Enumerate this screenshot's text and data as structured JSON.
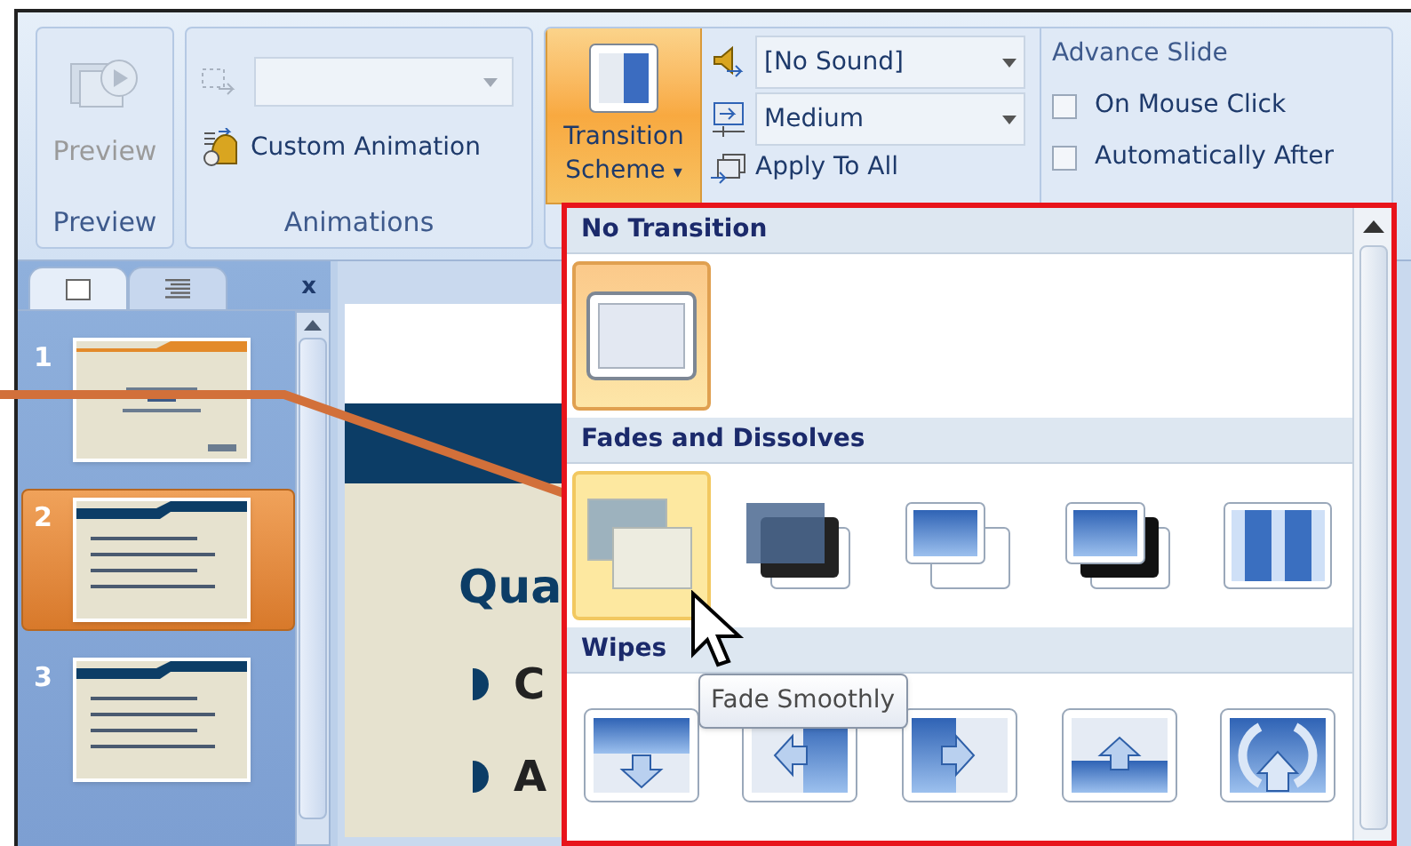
{
  "ribbon": {
    "preview_group": {
      "button": "Preview",
      "label": "Preview",
      "disabled": true
    },
    "animations_group": {
      "custom_animation": "Custom Animation",
      "label": "Animations"
    },
    "transition_group": {
      "scheme_button": "Transition",
      "scheme_button_line2": "Scheme",
      "caret": "▾",
      "sound": "[No Sound]",
      "speed": "Medium",
      "apply_all": "Apply To All"
    },
    "advance_group": {
      "title": "Advance Slide",
      "options": [
        {
          "label": "On Mouse Click",
          "checked": false
        },
        {
          "label": "Automatically After",
          "checked": false
        }
      ]
    }
  },
  "slides_pane": {
    "tabs": [
      {
        "kind": "slides",
        "selected": true
      },
      {
        "kind": "outline",
        "selected": false
      }
    ],
    "close": "x",
    "thumbnails": [
      {
        "number": "1",
        "kind": "title",
        "selected": false
      },
      {
        "number": "2",
        "kind": "bullets",
        "selected": true
      },
      {
        "number": "3",
        "kind": "bullets",
        "selected": false
      }
    ]
  },
  "slide": {
    "title": "Qua",
    "bullets": [
      "C",
      "A"
    ]
  },
  "gallery": {
    "sections": [
      {
        "title": "No Transition",
        "items": [
          {
            "kind": "none",
            "selected": true,
            "hovered": false
          }
        ]
      },
      {
        "title": "Fades and Dissolves",
        "items": [
          {
            "kind": "fade",
            "selected": false,
            "hovered": true
          },
          {
            "kind": "fade-black",
            "selected": false,
            "hovered": false
          },
          {
            "kind": "cut",
            "selected": false,
            "hovered": false
          },
          {
            "kind": "cut-black",
            "selected": false,
            "hovered": false
          },
          {
            "kind": "dissolve",
            "selected": false,
            "hovered": false
          }
        ]
      },
      {
        "title": "Wipes",
        "items": [
          {
            "kind": "wipe-down",
            "selected": false,
            "hovered": false
          },
          {
            "kind": "wipe-left",
            "selected": false,
            "hovered": false
          },
          {
            "kind": "wipe-right",
            "selected": false,
            "hovered": false
          },
          {
            "kind": "wipe-up",
            "selected": false,
            "hovered": false
          },
          {
            "kind": "wheel",
            "selected": false,
            "hovered": false
          }
        ]
      }
    ],
    "tooltip": "Fade Smoothly"
  }
}
